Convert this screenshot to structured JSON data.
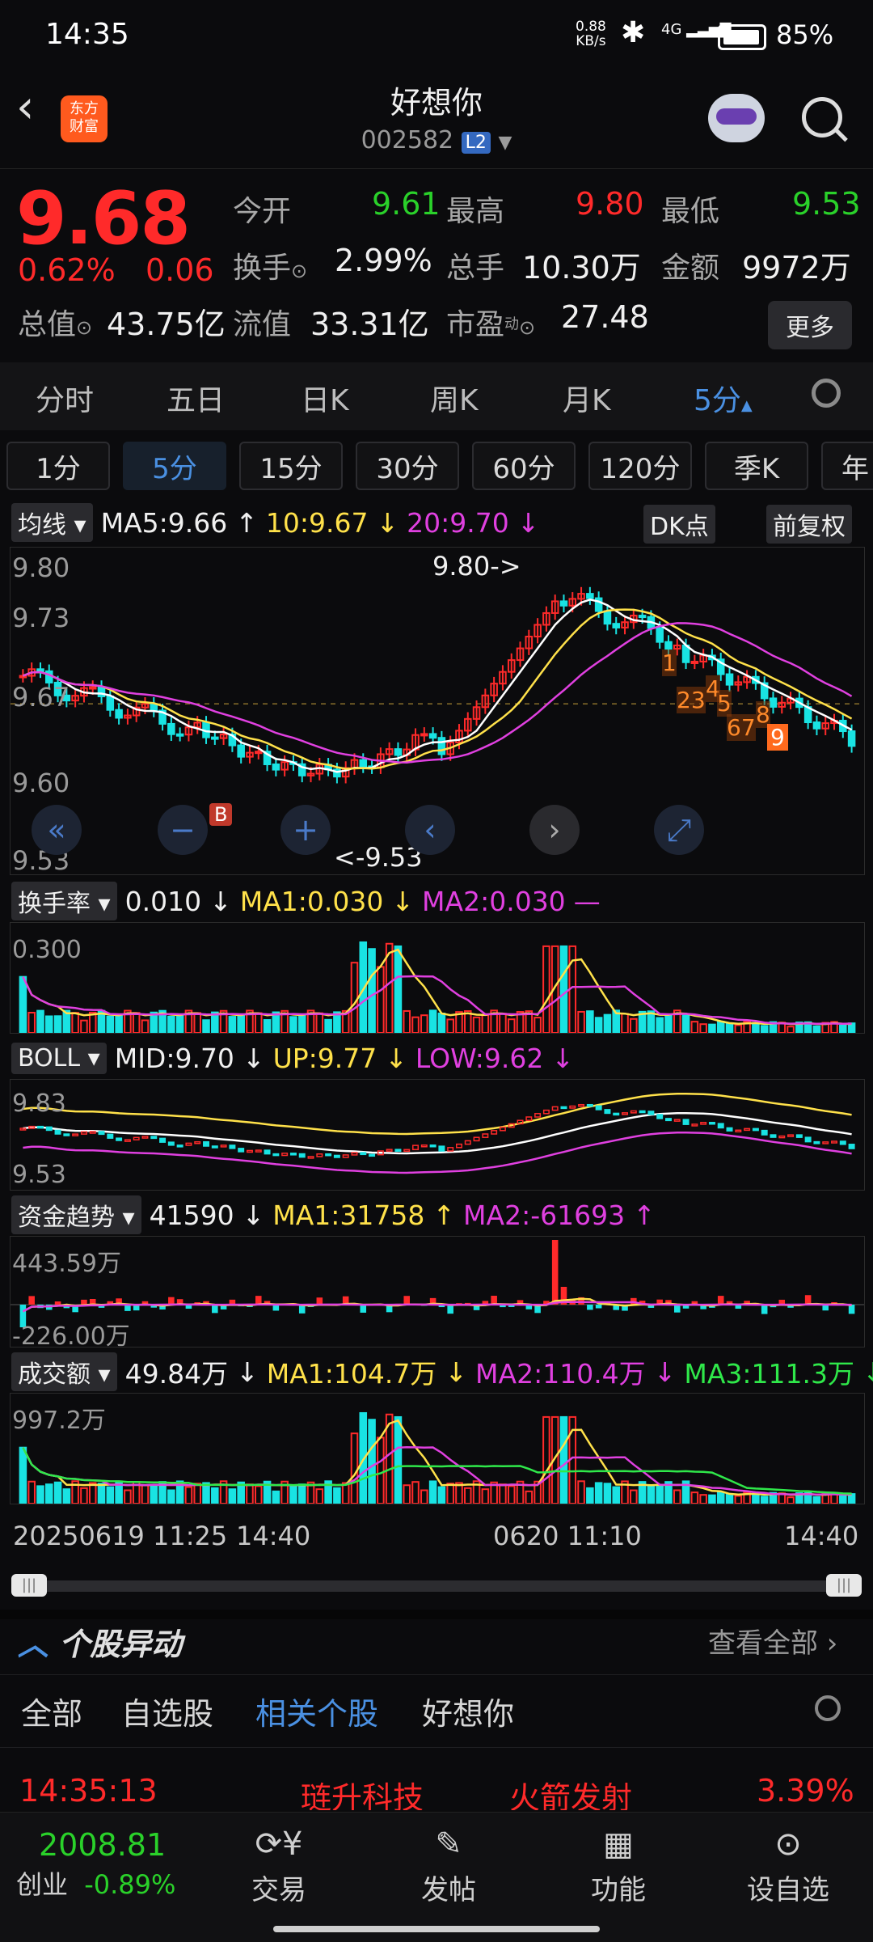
{
  "status": {
    "time": "14:35",
    "net_speed": "0.88",
    "net_unit": "KB/s",
    "signal": "4G",
    "battery": "85%"
  },
  "header": {
    "title": "好想你",
    "code": "002582",
    "level_badge": "L2",
    "logo_line1": "东方",
    "logo_line2": "财富"
  },
  "quote": {
    "price": "9.68",
    "change_pct": "0.62%",
    "change_abs": "0.06",
    "stats": [
      {
        "label": "今开",
        "value": "9.61"
      },
      {
        "label": "最高",
        "value": "9.80"
      },
      {
        "label": "最低",
        "value": "9.53"
      },
      {
        "label": "换手",
        "value": "2.99%"
      },
      {
        "label": "总手",
        "value": "10.30万"
      },
      {
        "label": "金额",
        "value": "9972万"
      },
      {
        "label": "总值",
        "value": "43.75亿"
      },
      {
        "label": "流值",
        "value": "33.31亿"
      },
      {
        "label": "市盈",
        "value": "27.48",
        "sup": "动"
      }
    ],
    "more_label": "更多"
  },
  "ktabs": [
    "分时",
    "五日",
    "日K",
    "周K",
    "月K",
    "5分"
  ],
  "periods": [
    "1分",
    "5分",
    "15分",
    "30分",
    "60分",
    "120分",
    "季K",
    "年"
  ],
  "ma_panel": {
    "title": "均线",
    "ma5": "MA5:9.66",
    "ma10": "10:9.67",
    "ma20": "20:9.70",
    "dk_label": "DK点",
    "adj_label": "前复权",
    "y_labels": [
      "9.80",
      "9.73",
      "9.67",
      "9.60",
      "9.53"
    ],
    "high_note": "9.80->",
    "low_note": "<-9.53",
    "buy_marker": "B",
    "seq_marks": [
      "1",
      "23",
      "4",
      "5",
      "67",
      "8",
      "9"
    ]
  },
  "turnover_panel": {
    "title": "换手率",
    "value": "0.010",
    "ma1": "MA1:0.030",
    "ma2": "MA2:0.030",
    "y_label": "0.300"
  },
  "boll_panel": {
    "title": "BOLL",
    "mid": "MID:9.70",
    "up": "UP:9.77",
    "low": "LOW:9.62",
    "y_top": "9.83",
    "y_bottom": "9.53"
  },
  "fund_panel": {
    "title": "资金趋势",
    "value": "41590",
    "ma1": "MA1:31758",
    "ma2": "MA2:-61693",
    "y_top": "443.59万",
    "y_bottom": "-226.00万"
  },
  "amount_panel": {
    "title": "成交额",
    "value": "49.84万",
    "ma1": "MA1:104.7万",
    "ma2": "MA2:110.4万",
    "ma3": "MA3:111.3万",
    "y_top": "997.2万"
  },
  "x_axis": [
    "20250619 11:25",
    "14:40",
    "0620 11:10",
    "14:40"
  ],
  "movers": {
    "title": "个股异动",
    "view_all": "查看全部",
    "tabs": [
      "全部",
      "自选股",
      "相关个股",
      "好想你"
    ],
    "row": {
      "time": "14:35:13",
      "name": "琏升科技",
      "event": "火箭发射",
      "pct": "3.39%"
    }
  },
  "bottom": {
    "index_value": "2008.81",
    "index_name": "创业",
    "index_change": "-0.89%",
    "nav": [
      "交易",
      "发帖",
      "功能",
      "设自选"
    ]
  },
  "colors": {
    "up": "#ff2a2a",
    "down": "#2ad12a",
    "accent": "#4a90e2",
    "ma5": "#ffffff",
    "ma10": "#ffe14a",
    "ma20": "#e040e0"
  }
}
